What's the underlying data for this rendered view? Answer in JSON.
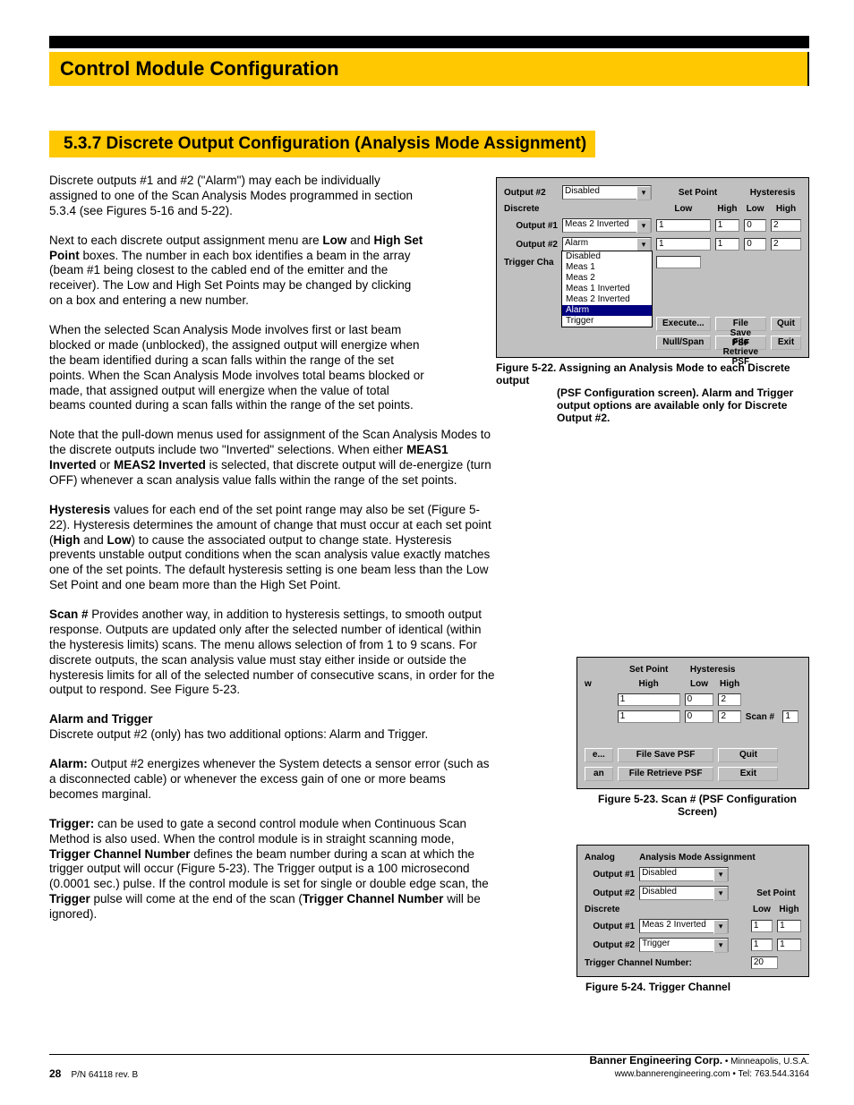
{
  "banner": "Control Module Configuration",
  "section_title": "5.3.7 Discrete Output Configuration (Analysis Mode Assignment)",
  "paras": {
    "p1": "Discrete outputs #1 and #2 (\"Alarm\") may each be individually assigned to one of the Scan Analysis Modes programmed in section 5.3.4 (see Figures 5-16 and 5-22).",
    "p2a": "Next to each discrete output assignment menu are ",
    "p2b": "Low",
    "p2c": " and ",
    "p2d": "High Set Point",
    "p2e": " boxes. The number in each box identifies a beam in the array (beam #1 being closest to the cabled end of the emitter and the receiver). The Low and High Set Points may be changed by clicking on a box and entering a new number.",
    "p3": "When the selected Scan Analysis Mode involves first or last beam blocked or made (unblocked), the assigned output will energize when the beam identified during a scan falls within the range of the set points. When the Scan Analysis Mode involves total beams blocked or made, that assigned output will energize when the value of total beams counted during a scan falls within the range of the set points.",
    "p4a": "Note that the pull-down menus used for assignment of the Scan Analysis Modes to the discrete outputs include two \"Inverted\" selections. When either ",
    "p4b": "MEAS1 Inverted",
    "p4c": " or ",
    "p4d": "MEAS2 Inverted",
    "p4e": " is selected, that discrete output will de-energize (turn OFF) whenever a scan analysis value falls within the range of the set points.",
    "p5a": "Hysteresis",
    "p5b": " values for each end of the set point range may also be set (Figure 5-22). Hysteresis determines the amount of change that must occur at each set point (",
    "p5c": "High",
    "p5d": " and ",
    "p5e": "Low",
    "p5f": ") to cause the associated output to change state. Hysteresis prevents unstable output conditions when the scan analysis value exactly matches one of the set points. The default hysteresis setting is one beam less than the Low Set Point and one beam more than the High Set Point.",
    "p6a": "Scan #",
    "p6b": " Provides another way, in addition to hysteresis settings, to smooth output response. Outputs are updated only after the selected number of identical (within the hysteresis limits) scans. The menu allows selection of from 1 to 9 scans. For discrete outputs, the scan analysis value must stay either inside or outside the hysteresis limits for all of the selected number of consecutive scans, in order for the output to respond. See Figure 5-23.",
    "subAT": "Alarm and Trigger",
    "p7": "Discrete output #2 (only) has two additional options: Alarm and Trigger.",
    "p8a": "Alarm:",
    "p8b": " Output #2 energizes whenever the System detects a sensor error (such as a disconnected cable) or whenever the excess gain of one or more beams becomes marginal.",
    "p9a": "Trigger:",
    "p9b": " can be used to gate a second control module when Continuous Scan Method is also used. When the control module is in straight scanning mode, ",
    "p9c": "Trigger Channel Number",
    "p9d": " defines the beam number during a scan at which the trigger output will occur (Figure 5-23). The Trigger output is a 100 microsecond (0.0001 sec.) pulse. If the control module is set for single or double edge scan, the ",
    "p9e": "Trigger",
    "p9f": " pulse will come at the end of the scan (",
    "p9g": "Trigger Channel Number",
    "p9h": " will be ignored)."
  },
  "fig22": {
    "caption_l1": "Figure 5-22.  Assigning an Analysis Mode to each Discrete output",
    "caption_l2": "(PSF Configuration screen). Alarm and Trigger output options are available only for Discrete Output #2.",
    "labels": {
      "output2_top": "Output #2",
      "discrete": "Discrete",
      "output1": "Output #1",
      "output2": "Output #2",
      "triggerch": "Trigger Cha",
      "setpoint": "Set Point",
      "hysteresis": "Hysteresis",
      "low": "Low",
      "high": "High"
    },
    "values": {
      "top_sel": "Disabled",
      "out1_sel": "Meas 2 Inverted",
      "out2_sel": "Alarm",
      "sp_low1": "1",
      "sp_high1": "1",
      "hy_low1": "0",
      "hy_high1": "2",
      "sp_low2": "1",
      "sp_high2": "1",
      "hy_low2": "0",
      "hy_high2": "2"
    },
    "dropdown": [
      "Disabled",
      "Meas 1",
      "Meas 2",
      "Meas 1 Inverted",
      "Meas 2 Inverted",
      "Alarm",
      "Trigger"
    ],
    "btns": {
      "execute": "Execute...",
      "save": "File Save PSF",
      "quit": "Quit",
      "nullspan": "Null/Span",
      "retrieve": "File Retrieve PSF",
      "exit": "Exit"
    }
  },
  "fig23": {
    "caption": "Figure 5-23.  Scan # (PSF Configuration Screen)",
    "labels": {
      "setpoint": "Set Point",
      "hyst": "Hysteresis",
      "w": "w",
      "high": "High",
      "low": "Low",
      "scan": "Scan #"
    },
    "values": {
      "sp1": "1",
      "sp2": "1",
      "hl1": "0",
      "hh1": "2",
      "hl2": "0",
      "hh2": "2",
      "scan": "1"
    },
    "btns": {
      "e": "e...",
      "save": "File Save PSF",
      "quit": "Quit",
      "an": "an",
      "retrieve": "File Retrieve PSF",
      "exit": "Exit"
    }
  },
  "fig24": {
    "caption": "Figure 5-24.  Trigger Channel",
    "labels": {
      "analog": "Analog",
      "ama": "Analysis Mode Assignment",
      "out1": "Output #1",
      "out2": "Output #2",
      "discrete": "Discrete",
      "setpoint": "Set Point",
      "low": "Low",
      "high": "High",
      "tcn": "Trigger Channel Number:"
    },
    "values": {
      "a_out1": "Disabled",
      "a_out2": "Disabled",
      "d_out1": "Meas 2 Inverted",
      "d_out2": "Trigger",
      "sp_low1": "1",
      "sp_high1": "1",
      "sp_low2": "1",
      "sp_high2": "1",
      "tcn": "20"
    }
  },
  "footer": {
    "pagenum": "28",
    "pn": "P/N 64118 rev. B",
    "company": "Banner Engineering Corp.",
    "loc": " • Minneapolis, U.S.A.",
    "web": "www.bannerengineering.com • Tel: 763.544.3164"
  }
}
